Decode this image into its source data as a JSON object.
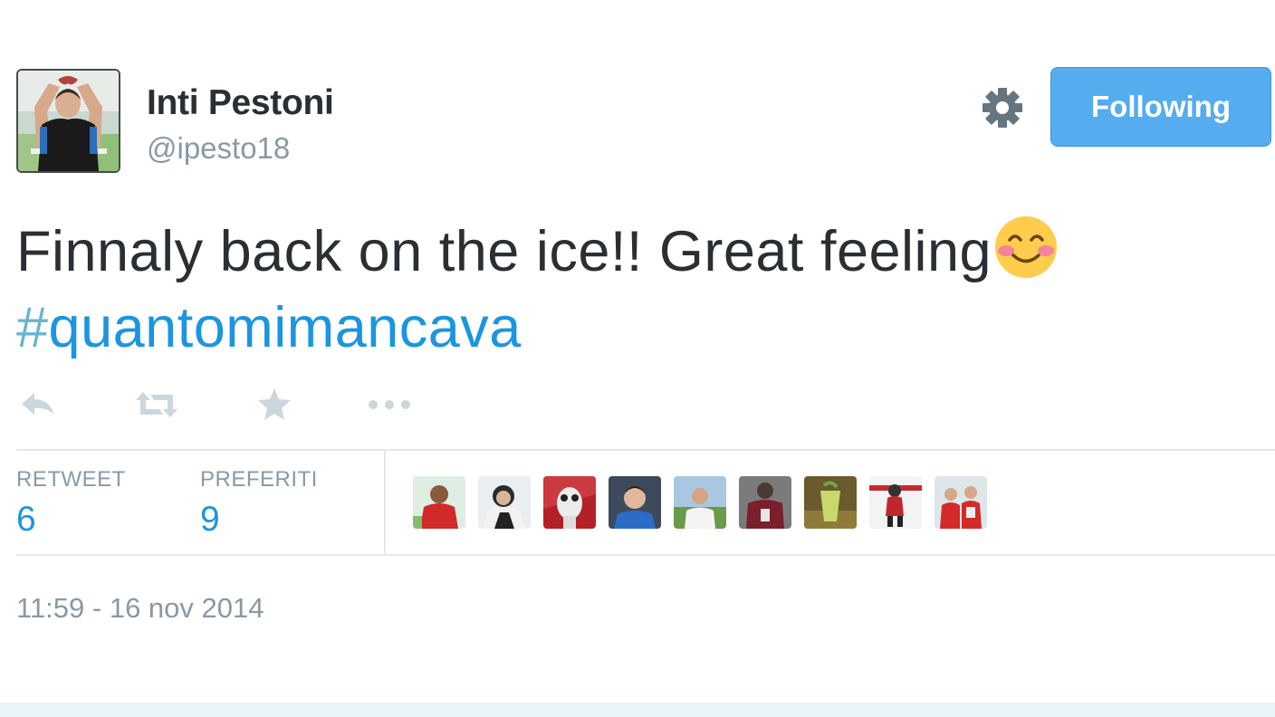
{
  "user": {
    "name": "Inti Pestoni",
    "handle": "@ipesto18"
  },
  "header": {
    "settings_icon": "gear-icon",
    "follow_label": "Following",
    "follow_color": "#55acee"
  },
  "tweet": {
    "text_line1": "Finnaly back on the ice!! Great feeling",
    "emoji": "smiling-face-with-blushing-cheeks",
    "hashtag_symbol": "#",
    "hashtag_text": "quantomimancava"
  },
  "actions": {
    "reply_icon": "reply-icon",
    "retweet_icon": "retweet-icon",
    "favorite_icon": "star-icon",
    "more_icon": "more-icon"
  },
  "stats": {
    "retweet_label": "RETWEET",
    "retweet_count": "6",
    "favorites_label": "PREFERITI",
    "favorites_count": "9"
  },
  "favoriters_count": 9,
  "timestamp": "11:59 - 16 nov 2014",
  "colors": {
    "text": "#292f33",
    "muted": "#8899a6",
    "link": "#1b95e0",
    "divider": "#e1e8ed"
  }
}
